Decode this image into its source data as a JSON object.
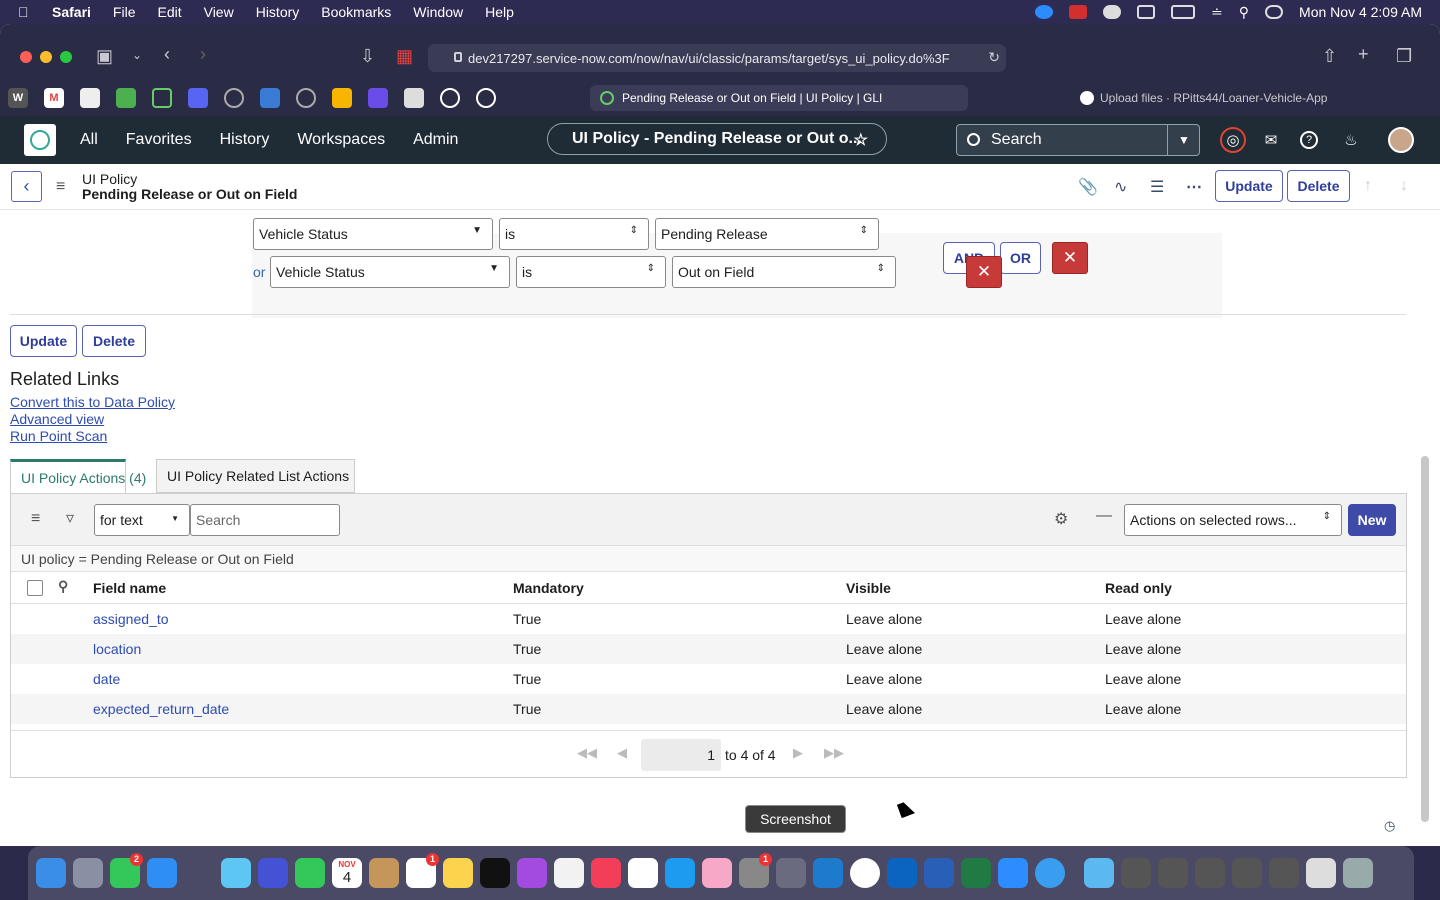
{
  "menubar": {
    "app": "Safari",
    "items": [
      "File",
      "Edit",
      "View",
      "History",
      "Bookmarks",
      "Window",
      "Help"
    ],
    "clock": "Mon Nov 4  2:09 AM",
    "status_icons": [
      "zoom-icon",
      "mcafee-icon",
      "cloud-icon",
      "display-icon",
      "battery-icon",
      "wifi-icon",
      "search-icon",
      "control-center-icon"
    ]
  },
  "browser": {
    "url": "dev217297.service-now.com/now/nav/ui/classic/params/target/sys_ui_policy.do%3F",
    "tabs": [
      {
        "label": "Pending Release or Out on Field | UI Policy | GLI",
        "active": true
      },
      {
        "label": "Upload files · RPitts44/Loaner-Vehicle-App",
        "active": false
      }
    ],
    "favorites": [
      "W",
      "M",
      "",
      "",
      "",
      "",
      "",
      "",
      "",
      "",
      "",
      "",
      "",
      ""
    ]
  },
  "sn_header": {
    "nav": [
      "All",
      "Favorites",
      "History",
      "Workspaces",
      "Admin"
    ],
    "context_title": "UI Policy - Pending Release or Out o...",
    "search_placeholder": "Search"
  },
  "form_header": {
    "table_label": "UI Policy",
    "record_name": "Pending Release or Out on Field",
    "update_label": "Update",
    "delete_label": "Delete"
  },
  "conditions": [
    {
      "prefix": "",
      "field": "Vehicle Status",
      "operator": "is",
      "value": "Pending Release"
    },
    {
      "prefix": "or",
      "field": "Vehicle Status",
      "operator": "is",
      "value": "Out on Field"
    }
  ],
  "cond_buttons": {
    "and": "AND",
    "or": "OR"
  },
  "form_actions": {
    "update": "Update",
    "delete": "Delete"
  },
  "related_links": {
    "title": "Related Links",
    "links": [
      "Convert this to Data Policy",
      "Advanced view",
      "Run Point Scan"
    ]
  },
  "related_tabs": [
    "UI Policy Actions (4)",
    "UI Policy Related List Actions"
  ],
  "list": {
    "search_field": "for text",
    "search_placeholder": "Search",
    "actions_select": "Actions on selected rows...",
    "new_label": "New",
    "filter": "UI policy = Pending Release or Out on Field",
    "columns": [
      "Field name",
      "Mandatory",
      "Visible",
      "Read only"
    ],
    "rows": [
      [
        "assigned_to",
        "True",
        "Leave alone",
        "Leave alone"
      ],
      [
        "location",
        "True",
        "Leave alone",
        "Leave alone"
      ],
      [
        "date",
        "True",
        "Leave alone",
        "Leave alone"
      ],
      [
        "expected_return_date",
        "True",
        "Leave alone",
        "Leave alone"
      ]
    ],
    "page": "1",
    "page_text": "to 4 of 4"
  },
  "tooltip": "Screenshot",
  "dock": [
    "Finder",
    "Launchpad",
    "Messages",
    "Mail",
    "Pen",
    "Maps",
    "Vectorworks",
    "FaceTime",
    "Calendar",
    "Contacts",
    "Reminders",
    "Notes",
    "TV",
    "Podcasts",
    "News",
    "Music",
    "Notion",
    "App Store",
    "Photos",
    "System Settings",
    "Screenshot",
    "VS Code",
    "Chrome",
    "Outlook",
    "Word",
    "Excel",
    "Zoom",
    "Safari",
    "Folder",
    "Trash"
  ],
  "dock_calendar": {
    "month": "NOV",
    "day": "4"
  },
  "dock_badges": {
    "messages": "2",
    "reminders": "1",
    "settings": "1"
  }
}
